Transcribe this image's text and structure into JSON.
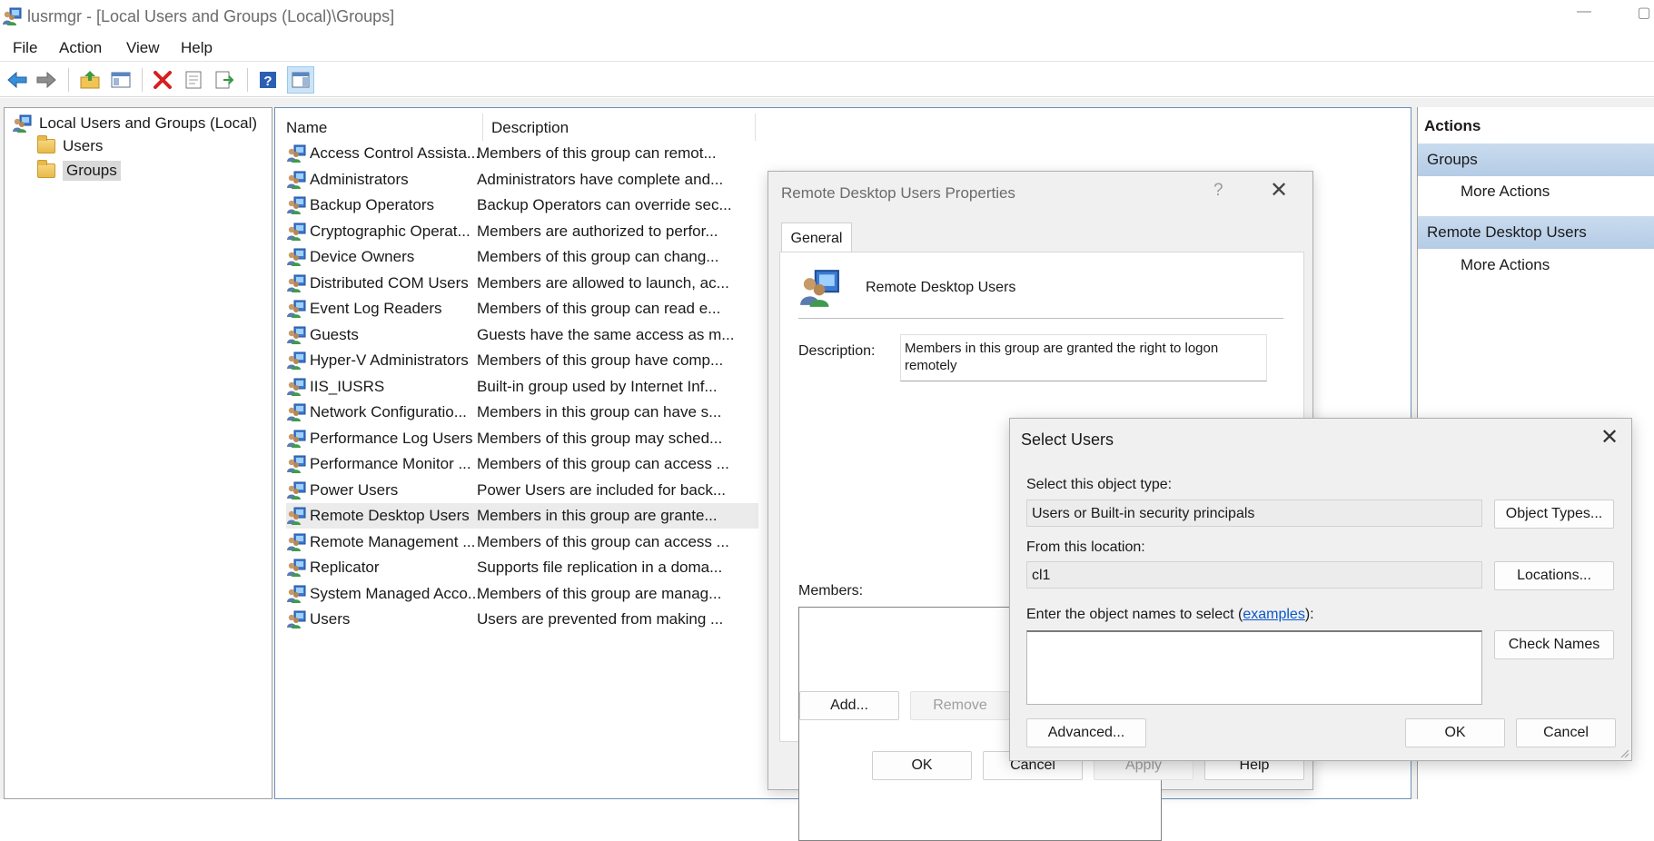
{
  "window": {
    "title": "lusrmgr - [Local Users and Groups (Local)\\Groups]",
    "minimize_glyph": "—",
    "restore_glyph": "▢"
  },
  "menu": [
    "File",
    "Action",
    "View",
    "Help"
  ],
  "toolbar": {
    "icons": [
      "back-arrow-icon",
      "forward-arrow-icon",
      "up-folder-icon",
      "show-hide-tree-icon",
      "delete-icon",
      "properties-icon",
      "export-list-icon",
      "help-icon",
      "action-pane-icon"
    ]
  },
  "tree": {
    "root": "Local Users and Groups (Local)",
    "children": [
      "Users",
      "Groups"
    ],
    "selected": "Groups"
  },
  "list": {
    "columns": [
      "Name",
      "Description"
    ],
    "rows": [
      {
        "name": "Access Control Assista...",
        "description": "Members of this group can remot..."
      },
      {
        "name": "Administrators",
        "description": "Administrators have complete and..."
      },
      {
        "name": "Backup Operators",
        "description": "Backup Operators can override sec..."
      },
      {
        "name": "Cryptographic Operat...",
        "description": "Members are authorized to perfor..."
      },
      {
        "name": "Device Owners",
        "description": "Members of this group can chang..."
      },
      {
        "name": "Distributed COM Users",
        "description": "Members are allowed to launch, ac..."
      },
      {
        "name": "Event Log Readers",
        "description": "Members of this group can read e..."
      },
      {
        "name": "Guests",
        "description": "Guests have the same access as m..."
      },
      {
        "name": "Hyper-V Administrators",
        "description": "Members of this group have comp..."
      },
      {
        "name": "IIS_IUSRS",
        "description": "Built-in group used by Internet Inf..."
      },
      {
        "name": "Network Configuratio...",
        "description": "Members in this group can have s..."
      },
      {
        "name": "Performance Log Users",
        "description": "Members of this group may sched..."
      },
      {
        "name": "Performance Monitor ...",
        "description": "Members of this group can access ..."
      },
      {
        "name": "Power Users",
        "description": "Power Users are included for back..."
      },
      {
        "name": "Remote Desktop Users",
        "description": "Members in this group are grante..."
      },
      {
        "name": "Remote Management ...",
        "description": "Members of this group can access ..."
      },
      {
        "name": "Replicator",
        "description": "Supports file replication in a doma..."
      },
      {
        "name": "System Managed Acco...",
        "description": "Members of this group are manag..."
      },
      {
        "name": "Users",
        "description": "Users are prevented from making ..."
      }
    ],
    "selected_index": 14
  },
  "actions": {
    "title": "Actions",
    "sections": [
      {
        "label": "Groups",
        "items": [
          "More Actions"
        ]
      },
      {
        "label": "Remote Desktop Users",
        "items": [
          "More Actions"
        ]
      }
    ]
  },
  "props_dialog": {
    "title": "Remote Desktop Users Properties",
    "help_glyph": "?",
    "close_glyph": "✕",
    "tab": "General",
    "group_name": "Remote Desktop Users",
    "description_label": "Description:",
    "description_value": "Members in this group are granted the right to logon remotely",
    "members_label": "Members:",
    "add_label": "Add...",
    "remove_label": "Remove",
    "ok_label": "OK",
    "cancel_label": "Cancel",
    "apply_label": "Apply",
    "help_label": "Help"
  },
  "select_dialog": {
    "title": "Select Users",
    "close_glyph": "✕",
    "object_type_label": "Select this object type:",
    "object_type_value": "Users or Built-in security principals",
    "object_types_button": "Object Types...",
    "location_label": "From this location:",
    "location_value": "cl1",
    "locations_button": "Locations...",
    "names_label_prefix": "Enter the object names to select (",
    "names_label_link": "examples",
    "names_label_suffix": "):",
    "names_value": "",
    "check_names_button": "Check Names",
    "advanced_button": "Advanced...",
    "ok_button": "OK",
    "cancel_button": "Cancel"
  }
}
